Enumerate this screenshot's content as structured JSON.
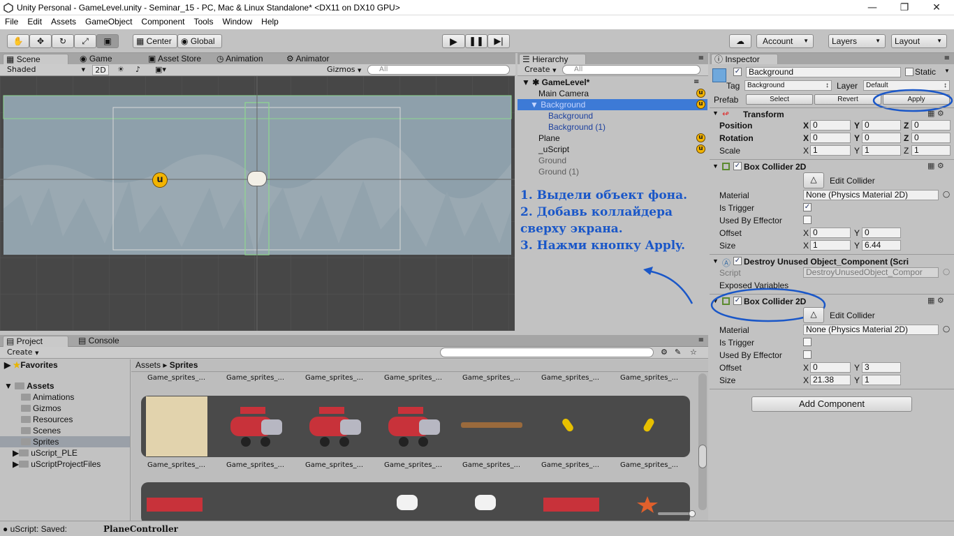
{
  "window": {
    "title": "Unity Personal - GameLevel.unity - Seminar_15 - PC, Mac & Linux Standalone* <DX11 on DX10 GPU>"
  },
  "menu": [
    "File",
    "Edit",
    "Assets",
    "GameObject",
    "Component",
    "Tools",
    "Window",
    "Help"
  ],
  "toolbar": {
    "center": "Center",
    "global": "Global",
    "account": "Account",
    "layers": "Layers",
    "layout": "Layout"
  },
  "scene_tabs": {
    "scene": "Scene",
    "game": "Game",
    "asset_store": "Asset Store",
    "animation": "Animation",
    "animator": "Animator"
  },
  "scene_bar": {
    "shading": "Shaded",
    "mode2d": "2D",
    "gizmos": "Gizmos",
    "search": "All"
  },
  "hierarchy": {
    "tab": "Hierarchy",
    "create": "Create",
    "search": "All",
    "root": "GameLevel*",
    "items": [
      {
        "label": "Main Camera"
      },
      {
        "label": "Background"
      },
      {
        "label": "Background"
      },
      {
        "label": "Background (1)"
      },
      {
        "label": "Plane"
      },
      {
        "label": "_uScript"
      },
      {
        "label": "Ground"
      },
      {
        "label": "Ground (1)"
      }
    ]
  },
  "instructions": [
    "1. Выдели объект фона.",
    "2. Добавь коллайдера",
    "сверху экрана.",
    "3. Нажми кнопку Apply."
  ],
  "inspector": {
    "tab": "Inspector",
    "name": "Background",
    "static": "Static",
    "tag_label": "Tag",
    "tag": "Background",
    "layer_label": "Layer",
    "layer": "Default",
    "prefab_label": "Prefab",
    "select": "Select",
    "revert": "Revert",
    "apply": "Apply",
    "transform": {
      "title": "Transform",
      "position": {
        "label": "Position",
        "x": "0",
        "y": "0",
        "z": "0"
      },
      "rotation": {
        "label": "Rotation",
        "x": "0",
        "y": "0",
        "z": "0"
      },
      "scale": {
        "label": "Scale",
        "x": "1",
        "y": "1",
        "z": "1"
      }
    },
    "collider1": {
      "title": "Box Collider 2D",
      "edit": "Edit Collider",
      "material_label": "Material",
      "material": "None (Physics Material 2D)",
      "trigger_label": "Is Trigger",
      "effector_label": "Used By Effector",
      "offset_label": "Offset",
      "offset_x": "0",
      "offset_y": "0",
      "size_label": "Size",
      "size_x": "1",
      "size_y": "6.44"
    },
    "script_comp": {
      "title": "Destroy Unused Object_Component (Scri",
      "script_label": "Script",
      "script": "DestroyUnusedObject_Compor",
      "exposed": "Exposed Variables"
    },
    "collider2": {
      "title": "Box Collider 2D",
      "edit": "Edit Collider",
      "material_label": "Material",
      "material": "None (Physics Material 2D)",
      "trigger_label": "Is Trigger",
      "effector_label": "Used By Effector",
      "offset_label": "Offset",
      "offset_x": "0",
      "offset_y": "3",
      "size_label": "Size",
      "size_x": "21.38",
      "size_y": "1"
    },
    "add_component": "Add Component"
  },
  "project": {
    "tab": "Project",
    "console_tab": "Console",
    "create": "Create",
    "favorites": "Favorites",
    "assets": "Assets",
    "folders": [
      "Animations",
      "Gizmos",
      "Resources",
      "Scenes",
      "Sprites",
      "uScript_PLE",
      "uScriptProjectFiles"
    ],
    "breadcrumb_root": "Assets",
    "breadcrumb_leaf": "Sprites",
    "asset_names": [
      "Game_sprites_...",
      "Game_sprites_...",
      "Game_sprites_...",
      "Game_sprites_...",
      "Game_sprites_...",
      "Game_sprites_...",
      "Game_sprites_..."
    ]
  },
  "status": {
    "left": "uScript: Saved:",
    "right": "PlaneController"
  },
  "colors": {
    "accent": "#3d7ad6",
    "annotation": "#1a57c8",
    "selection": "#3d7ad6"
  }
}
